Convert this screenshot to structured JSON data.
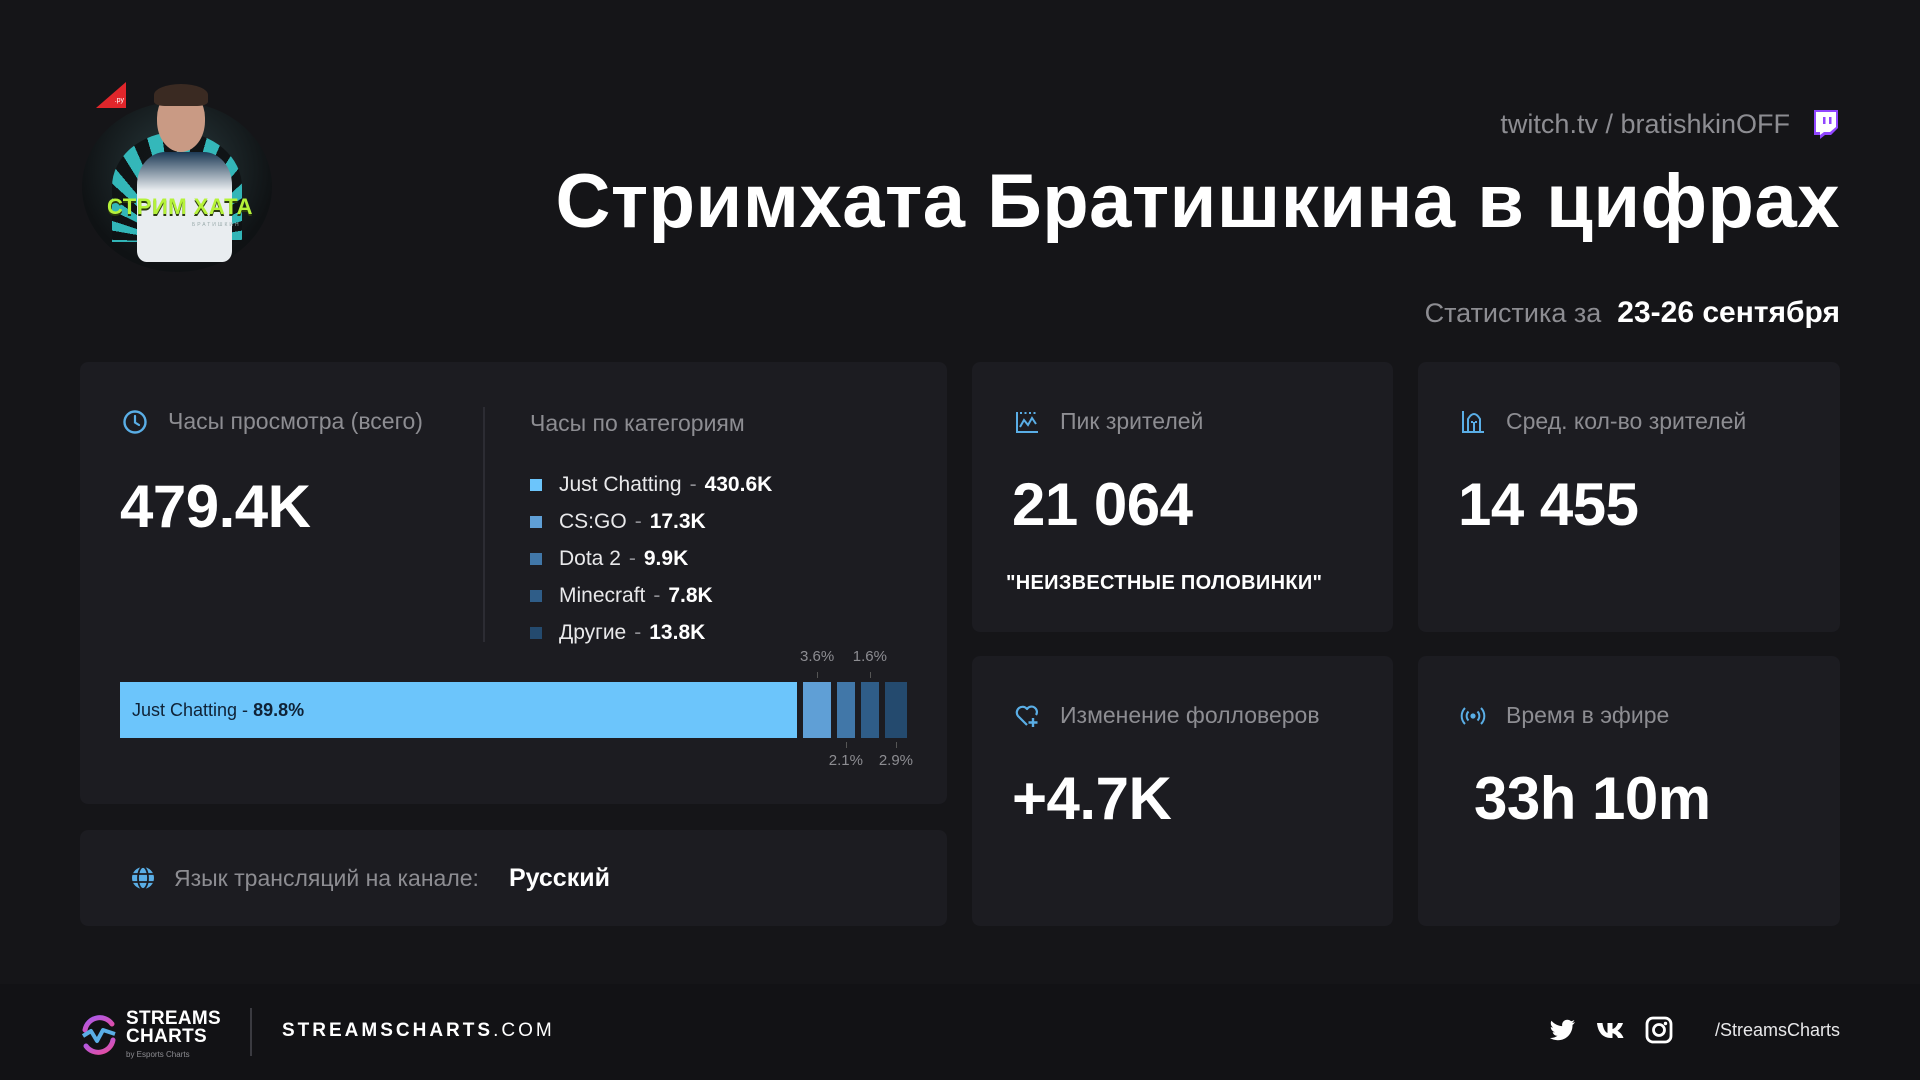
{
  "header": {
    "channel_link": "twitch.tv / bratishkinOFF",
    "title": "Стримхата Братишкина в цифрах",
    "period_label": "Статистика за",
    "period_value": "23-26 сентября",
    "avatar_text": "СТРИМ ХАТА",
    "avatar_subtext": "БРАТИШКИН",
    "avatar_tag": ".ру"
  },
  "hours": {
    "label": "Часы просмотра (всего)",
    "value": "479.4K",
    "icon": "clock-icon"
  },
  "categories": {
    "title": "Часы по категориям",
    "items": [
      {
        "name": "Just Chatting",
        "value": "430.6K",
        "percent": 89.8,
        "percent_label": "89.8%",
        "color": "#6cc5fb"
      },
      {
        "name": "CS:GO",
        "value": "17.3K",
        "percent": 3.6,
        "percent_label": "3.6%",
        "color": "#5f9fd6"
      },
      {
        "name": "Dota 2",
        "value": "9.9K",
        "percent": 2.1,
        "percent_label": "2.1%",
        "color": "#4177a8"
      },
      {
        "name": "Minecraft",
        "value": "7.8K",
        "percent": 1.6,
        "percent_label": "1.6%",
        "color": "#2f5d88"
      },
      {
        "name": "Другие",
        "value": "13.8K",
        "percent": 2.9,
        "percent_label": "2.9%",
        "color": "#244a6e"
      }
    ],
    "separator": "-"
  },
  "language": {
    "label": "Язык трансляций на канале:",
    "value": "Русский",
    "icon": "globe-icon"
  },
  "peak": {
    "label": "Пик зрителей",
    "value": "21 064",
    "note": "\"НЕИЗВЕСТНЫЕ ПОЛОВИНКИ\"",
    "icon": "peak-chart-icon"
  },
  "average": {
    "label": "Сред. кол-во зрителей",
    "value": "14 455",
    "icon": "average-chart-icon"
  },
  "followers": {
    "label": "Изменение фолловеров",
    "value": "+4.7K",
    "icon": "heart-plus-icon"
  },
  "airtime": {
    "label": "Время в эфире",
    "value": "33h 10m",
    "icon": "broadcast-icon"
  },
  "footer": {
    "logo_line1": "STREAMS",
    "logo_line2": "CHARTS",
    "logo_by": "by Esports Charts",
    "site_bold": "STREAMSCHARTS",
    "site_rest": ".COM",
    "social_handle": "/StreamsCharts",
    "social_icons": [
      "twitter-icon",
      "vk-icon",
      "instagram-icon"
    ]
  },
  "colors": {
    "accent": "#6cc5fb",
    "icon_blue": "#5aaee6",
    "twitch": "#9146ff",
    "muted_text": "#8d8d92",
    "card_bg": "#1c1c21",
    "page_bg": "#151518"
  }
}
